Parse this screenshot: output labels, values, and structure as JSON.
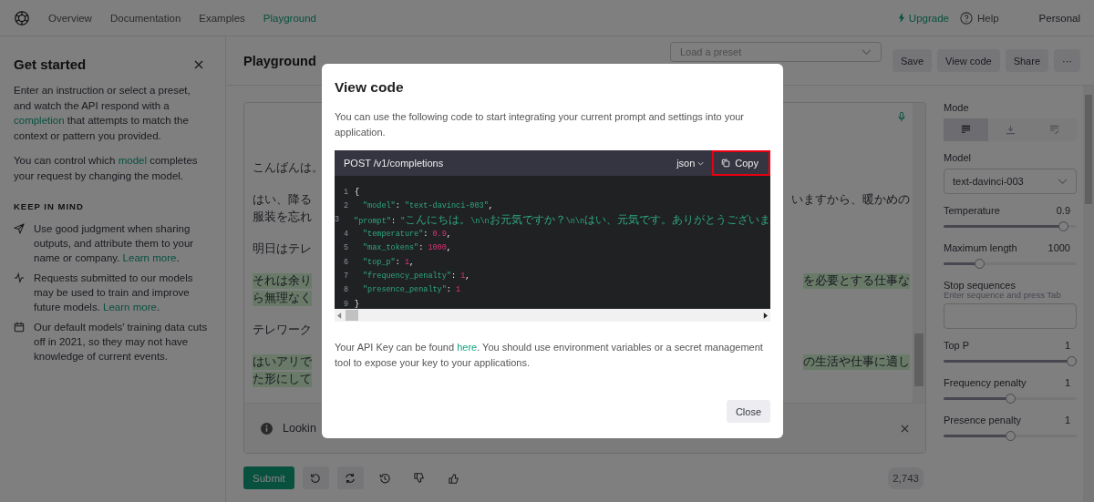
{
  "nav": {
    "links": [
      {
        "label": "Overview",
        "selected": false
      },
      {
        "label": "Documentation",
        "selected": false
      },
      {
        "label": "Examples",
        "selected": false
      },
      {
        "label": "Playground",
        "selected": true
      }
    ],
    "upgrade": "Upgrade",
    "help": "Help",
    "account": "Personal"
  },
  "sidebar": {
    "title": "Get started",
    "intro": [
      [
        {
          "kind": "text",
          "text": "Enter an instruction or select a preset, and watch the API respond with a "
        },
        {
          "kind": "link",
          "text": "completion"
        },
        {
          "kind": "text",
          "text": " that attempts to match the context or pattern you provided."
        }
      ],
      [
        {
          "kind": "text",
          "text": "You can control which "
        },
        {
          "kind": "link",
          "text": "model"
        },
        {
          "kind": "text",
          "text": " completes your request by changing the model."
        }
      ]
    ],
    "section": "KEEP IN MIND",
    "tips": [
      [
        {
          "kind": "text",
          "text": "Use good judgment when sharing outputs, and attribute them to your name or company. "
        },
        {
          "kind": "link",
          "text": "Learn more"
        },
        {
          "kind": "text",
          "text": "."
        }
      ],
      [
        {
          "kind": "text",
          "text": "Requests submitted to our models may be used to train and improve future models. "
        },
        {
          "kind": "link",
          "text": "Learn more"
        },
        {
          "kind": "text",
          "text": "."
        }
      ],
      [
        {
          "kind": "text",
          "text": "Our default models' training data cuts off in 2021, so they may not have knowledge of current events."
        }
      ]
    ]
  },
  "header": {
    "title": "Playground",
    "preset": {
      "placeholder": "Load a preset"
    },
    "buttons": [
      "Save",
      "View code",
      "Share",
      "···"
    ]
  },
  "editor": {
    "paragraphs": [
      {
        "highlighted": false,
        "lines": [
          {
            "left": "こんばんは。"
          }
        ]
      },
      {
        "highlighted": false,
        "lines": [
          {
            "left": "はい、降る",
            "right": "いますから、暖かめの"
          },
          {
            "left": "服装を忘れ"
          }
        ]
      },
      {
        "highlighted": false,
        "lines": [
          {
            "left": "明日はテレ"
          }
        ]
      },
      {
        "highlighted": true,
        "lines": [
          {
            "left": "それは余り",
            "right": "を必要とする仕事な"
          },
          {
            "left": "ら無理なく"
          }
        ]
      },
      {
        "highlighted": false,
        "lines": [
          {
            "left": "テレワーク"
          }
        ]
      },
      {
        "highlighted": true,
        "lines": [
          {
            "left": "はいアリで",
            "right": "の生活や仕事に適し"
          },
          {
            "left": "た形にして"
          }
        ]
      }
    ],
    "notice": "Lookin"
  },
  "actions": {
    "submit": "Submit",
    "tokens": "2,743"
  },
  "settings": [
    {
      "kind": "mode",
      "label": "Mode",
      "options": [
        {
          "selected": true
        },
        {
          "selected": false
        },
        {
          "selected": false
        }
      ]
    },
    {
      "kind": "select",
      "label": "Model",
      "value": "text-davinci-003"
    },
    {
      "kind": "slider",
      "label": "Temperature",
      "reading": "0.9",
      "level": 0.93
    },
    {
      "kind": "slider",
      "label": "Maximum length",
      "reading": "1000",
      "level": 0.25
    },
    {
      "kind": "stop",
      "label": "Stop sequences",
      "hint": "Enter sequence and press Tab"
    },
    {
      "kind": "slider",
      "label": "Top P",
      "reading": "1",
      "level": 1
    },
    {
      "kind": "slider",
      "label": "Frequency penalty",
      "reading": "1",
      "level": 0.5
    },
    {
      "kind": "slider",
      "label": "Presence penalty",
      "reading": "1",
      "level": 0.5
    }
  ],
  "modal": {
    "title": "View code",
    "description": "You can use the following code to start integrating your current prompt and settings into your application.",
    "endpoint": "POST /v1/completions",
    "language": "json",
    "copy": {
      "label": "Copy",
      "highlighted": true
    },
    "lines": [
      {
        "num": "1",
        "kind": "brace",
        "tokens": [
          {
            "kind": "punct",
            "text": "{"
          }
        ]
      },
      {
        "num": "2",
        "kind": "entry",
        "tokens": [
          {
            "kind": "key",
            "text": "\"model\""
          },
          {
            "kind": "punct",
            "text": ": "
          },
          {
            "kind": "string",
            "text": "\"text-davinci-003\""
          },
          {
            "kind": "punct",
            "text": ","
          }
        ]
      },
      {
        "num": "3",
        "kind": "entry",
        "tokens": [
          {
            "kind": "key",
            "text": "\"prompt\""
          },
          {
            "kind": "punct",
            "text": ": "
          },
          {
            "kind": "string",
            "text": "\""
          },
          {
            "kind": "wide-string",
            "text": "こんにちは。"
          },
          {
            "kind": "string",
            "text": "\\n\\n"
          },
          {
            "kind": "wide-string",
            "text": "お元気ですか？"
          },
          {
            "kind": "string",
            "text": "\\n\\n"
          },
          {
            "kind": "wide-string",
            "text": "はい、元気です。ありがとうございま"
          }
        ]
      },
      {
        "num": "4",
        "kind": "entry",
        "tokens": [
          {
            "kind": "key",
            "text": "\"temperature\""
          },
          {
            "kind": "punct",
            "text": ": "
          },
          {
            "kind": "number",
            "text": "0.9"
          },
          {
            "kind": "punct",
            "text": ","
          }
        ]
      },
      {
        "num": "5",
        "kind": "entry",
        "tokens": [
          {
            "kind": "key",
            "text": "\"max_tokens\""
          },
          {
            "kind": "punct",
            "text": ": "
          },
          {
            "kind": "number",
            "text": "1000"
          },
          {
            "kind": "punct",
            "text": ","
          }
        ]
      },
      {
        "num": "6",
        "kind": "entry",
        "tokens": [
          {
            "kind": "key",
            "text": "\"top_p\""
          },
          {
            "kind": "punct",
            "text": ": "
          },
          {
            "kind": "number",
            "text": "1"
          },
          {
            "kind": "punct",
            "text": ","
          }
        ]
      },
      {
        "num": "7",
        "kind": "entry",
        "tokens": [
          {
            "kind": "key",
            "text": "\"frequency_penalty\""
          },
          {
            "kind": "punct",
            "text": ": "
          },
          {
            "kind": "number",
            "text": "1"
          },
          {
            "kind": "punct",
            "text": ","
          }
        ]
      },
      {
        "num": "8",
        "kind": "entry",
        "tokens": [
          {
            "kind": "key",
            "text": "\"presence_penalty\""
          },
          {
            "kind": "punct",
            "text": ": "
          },
          {
            "kind": "number",
            "text": "1"
          }
        ]
      },
      {
        "num": "9",
        "kind": "brace",
        "tokens": [
          {
            "kind": "punct",
            "text": "}"
          }
        ]
      }
    ],
    "footer": [
      {
        "kind": "text",
        "text": "Your API Key can be found "
      },
      {
        "kind": "link",
        "text": "here"
      },
      {
        "kind": "text",
        "text": ". You should use environment variables or a secret management tool to expose your key to your applications."
      }
    ],
    "close": "Close"
  }
}
